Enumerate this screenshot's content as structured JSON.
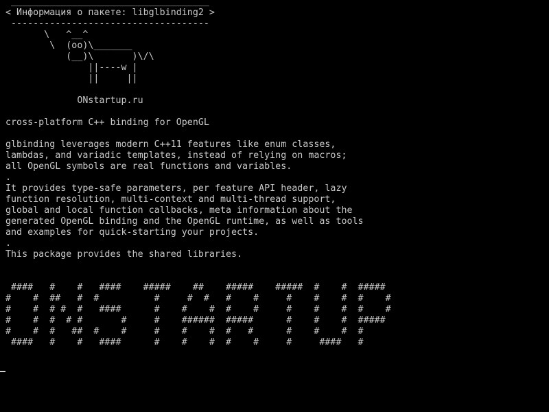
{
  "header": {
    "top_border": " ____________________________________",
    "title_line": "< Информация о пакете: libglbinding2 >",
    "bottom_border": " ------------------------------------"
  },
  "cow": [
    "       \\   ^__^",
    "        \\  (oo)\\_______",
    "           (__)\\       )\\/\\",
    "               ||----w |",
    "               ||     ||"
  ],
  "site": "             ONstartup.ru",
  "description": {
    "summary": "cross-platform C++ binding for OpenGL",
    "paragraph1": [
      "glbinding leverages modern C++11 features like enum classes,",
      "lambdas, and variadic templates, instead of relying on macros;",
      "all OpenGL symbols are real functions and variables."
    ],
    "separator1": ".",
    "paragraph2": [
      "It provides type-safe parameters, per feature API header, lazy",
      "function resolution, multi-context and multi-thread support,",
      "global and local function callbacks, meta information about the",
      "generated OpenGL binding and the OpenGL runtime, as well as tools",
      "and examples for quick-starting your projects."
    ],
    "separator2": ".",
    "paragraph3": "This package provides the shared libraries."
  },
  "banner": [
    " ####   #    #   ####    #####    ##    #####    #####  #    #  #####",
    "#    #  ##   #  #          #     #  #   #    #     #    #    #  #    #",
    "#    #  # #  #   ####      #    #    #  #    #     #    #    #  #    #",
    "#    #  #  # #       #     #    ######  #####      #    #    #  #####",
    "#    #  #   ##  #    #     #    #    #  #   #      #    #    #  #",
    " ####   #    #   ####      #    #    #  #    #     #     ####   #"
  ]
}
